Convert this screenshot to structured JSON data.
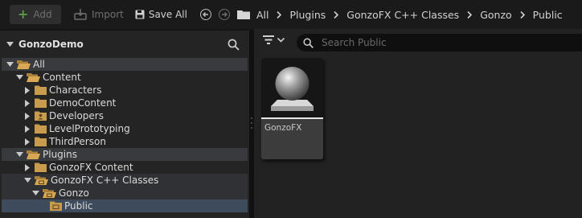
{
  "toolbar": {
    "add_label": "Add",
    "import_label": "Import",
    "save_all_label": "Save All"
  },
  "breadcrumbs": [
    "All",
    "Plugins",
    "GonzoFX C++ Classes",
    "Gonzo",
    "Public"
  ],
  "left_panel": {
    "title": "GonzoDemo",
    "tree": [
      {
        "label": "All"
      },
      {
        "label": "Content"
      },
      {
        "label": "Characters"
      },
      {
        "label": "DemoContent"
      },
      {
        "label": "Developers"
      },
      {
        "label": "LevelPrototyping"
      },
      {
        "label": "ThirdPerson"
      },
      {
        "label": "Plugins"
      },
      {
        "label": "GonzoFX Content"
      },
      {
        "label": "GonzoFX C++ Classes"
      },
      {
        "label": "Gonzo"
      },
      {
        "label": "Public"
      }
    ]
  },
  "search": {
    "placeholder": "Search Public"
  },
  "asset": {
    "name": "GonzoFX"
  },
  "colors": {
    "accent_green": "#5a9a43",
    "folder": "#c89a4a",
    "selection": "#3d4b5c"
  },
  "icons": {
    "add": "plus-icon",
    "import": "import-icon",
    "save": "floppy-disk-icon",
    "back": "back-arrow-icon",
    "forward": "forward-arrow-icon",
    "folder": "folder-icon",
    "search": "search-icon",
    "filter": "filter-icon"
  }
}
